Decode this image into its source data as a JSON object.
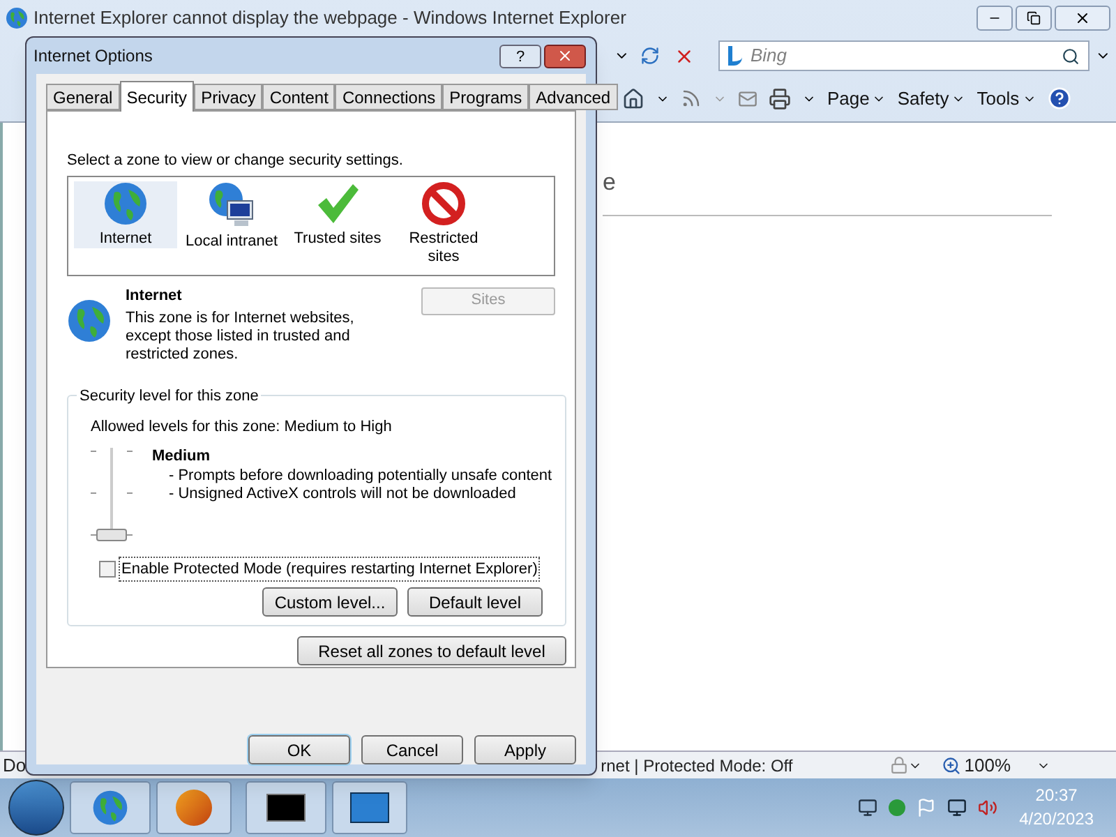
{
  "browser": {
    "title": "Internet Explorer cannot display the webpage - Windows Internet Explorer",
    "search_placeholder": "Bing",
    "commands": [
      {
        "label": "Page"
      },
      {
        "label": "Safety"
      },
      {
        "label": "Tools"
      }
    ],
    "page_text": "e",
    "status_left": "Do",
    "status_text": "rnet | Protected Mode: Off",
    "zoom": "100%"
  },
  "dialog": {
    "title": "Internet Options",
    "help": "?",
    "tabs": [
      {
        "label": "General",
        "selected": false
      },
      {
        "label": "Security",
        "selected": true
      },
      {
        "label": "Privacy",
        "selected": false
      },
      {
        "label": "Content",
        "selected": false
      },
      {
        "label": "Connections",
        "selected": false
      },
      {
        "label": "Programs",
        "selected": false
      },
      {
        "label": "Advanced",
        "selected": false
      }
    ],
    "zone_prompt": "Select a zone to view or change security settings.",
    "zones": [
      {
        "label": "Internet",
        "kind": "globe",
        "selected": true
      },
      {
        "label": "Local intranet",
        "kind": "intranet",
        "selected": false
      },
      {
        "label": "Trusted sites",
        "kind": "check",
        "selected": false
      },
      {
        "label": "Restricted sites",
        "kind": "blocked",
        "selected": false
      }
    ],
    "zone_name": "Internet",
    "zone_description": "This zone is for Internet websites, except those listed in trusted and restricted zones.",
    "sites_button": {
      "label": "Sites",
      "disabled": true
    },
    "level_group": "Security level for this zone",
    "allowed": "Allowed levels for this zone: Medium to High",
    "slider": {
      "level": 0
    },
    "level_name": "Medium",
    "level_details": [
      "- Prompts before downloading potentially unsafe content",
      "- Unsigned ActiveX controls will not be downloaded"
    ],
    "protected_mode": {
      "label": "Enable Protected Mode (requires restarting Internet Explorer)",
      "checked": false
    },
    "level_buttons": [
      "Custom level...",
      "Default level"
    ],
    "reset_button": "Reset all zones to default level",
    "buttons": [
      {
        "label": "OK",
        "default": true
      },
      {
        "label": "Cancel",
        "default": false
      },
      {
        "label": "Apply",
        "default": false
      }
    ]
  },
  "taskbar": {
    "time": "20:37",
    "date": "4/20/2023"
  }
}
